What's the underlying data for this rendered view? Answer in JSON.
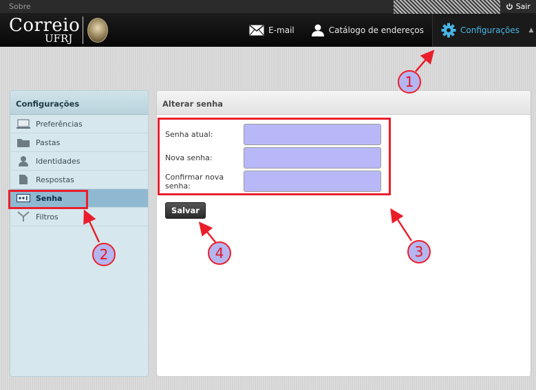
{
  "topbar": {
    "about_label": "Sobre",
    "logout_label": "Sair"
  },
  "header": {
    "logo_line1": "Correio",
    "logo_line2": "UFRJ",
    "nav": [
      {
        "label": "E-mail",
        "icon": "envelope-icon"
      },
      {
        "label": "Catálogo de endereços",
        "icon": "person-icon"
      },
      {
        "label": "Configurações",
        "icon": "gear-icon",
        "active": true
      }
    ]
  },
  "sidebar": {
    "title": "Configurações",
    "items": [
      {
        "label": "Preferências",
        "icon": "monitor-icon"
      },
      {
        "label": "Pastas",
        "icon": "folder-icon"
      },
      {
        "label": "Identidades",
        "icon": "identity-icon"
      },
      {
        "label": "Respostas",
        "icon": "document-icon"
      },
      {
        "label": "Senha",
        "icon": "password-icon",
        "selected": true
      },
      {
        "label": "Filtros",
        "icon": "filter-icon"
      }
    ]
  },
  "panel": {
    "title": "Alterar senha",
    "fields": [
      {
        "label": "Senha atual:",
        "value": ""
      },
      {
        "label": "Nova senha:",
        "value": ""
      },
      {
        "label": "Confirmar nova senha:",
        "value": ""
      }
    ],
    "save_label": "Salvar"
  },
  "annotations": {
    "n1": "1",
    "n2": "2",
    "n3": "3",
    "n4": "4"
  },
  "colors": {
    "accent": "#48b6e8",
    "annotation": "#ea1e2a",
    "field_fill": "#b8b8f8",
    "sidebar_selected": "#8fb9d1"
  }
}
